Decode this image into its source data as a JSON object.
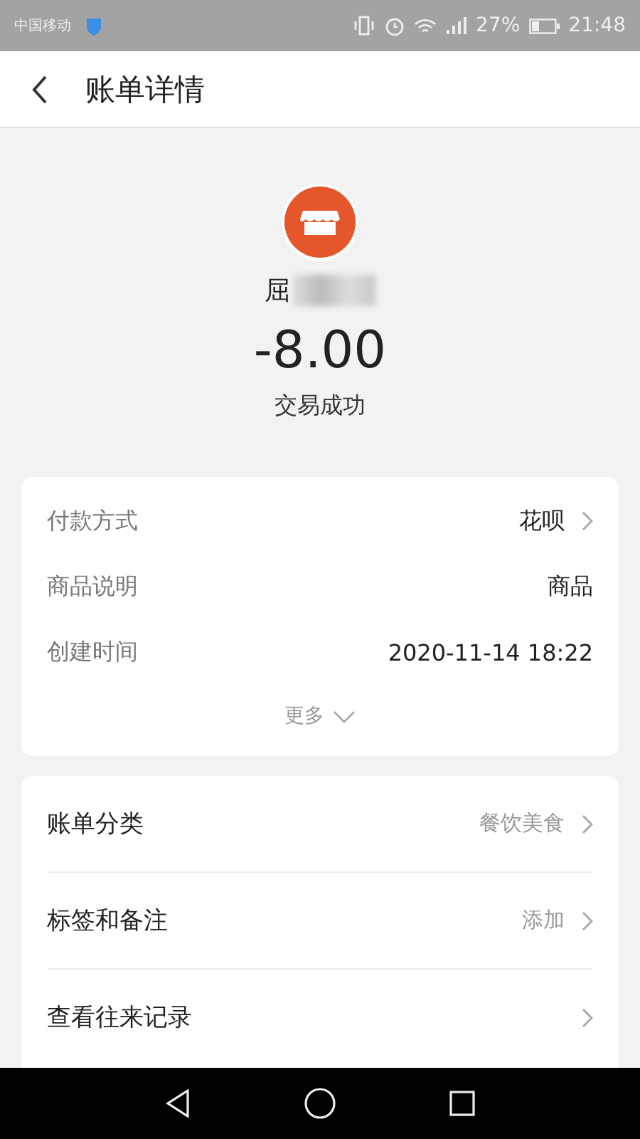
{
  "status_bar": {
    "carrier": "中国移动",
    "battery_text": "27%",
    "time": "21:48"
  },
  "header": {
    "title": "账单详情"
  },
  "summary": {
    "merchant": "屈",
    "amount": "-8.00",
    "status": "交易成功"
  },
  "details": {
    "rows": [
      {
        "label": "付款方式",
        "value": "花呗",
        "chevron": true
      },
      {
        "label": "商品说明",
        "value": "商品",
        "chevron": false
      },
      {
        "label": "创建时间",
        "value": "2020-11-14 18:22",
        "chevron": false
      }
    ],
    "more": "更多"
  },
  "actions": [
    {
      "label": "账单分类",
      "value": "餐饮美食"
    },
    {
      "label": "标签和备注",
      "value": "添加"
    },
    {
      "label": "查看往来记录"
    }
  ]
}
